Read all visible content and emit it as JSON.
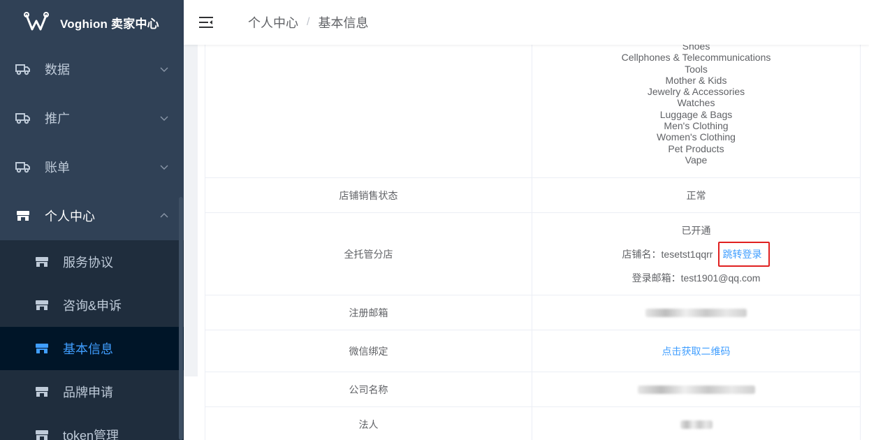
{
  "sidebar": {
    "logo_text": "Voghion 卖家中心",
    "menu": [
      {
        "label": "数据",
        "icon": "truck-icon"
      },
      {
        "label": "推广",
        "icon": "truck-icon"
      },
      {
        "label": "账单",
        "icon": "truck-icon"
      },
      {
        "label": "个人中心",
        "icon": "store-icon"
      }
    ],
    "submenu": [
      {
        "label": "服务协议",
        "icon": "store-icon"
      },
      {
        "label": "咨询&申诉",
        "icon": "store-icon"
      },
      {
        "label": "基本信息",
        "icon": "store-icon",
        "active": true
      },
      {
        "label": "品牌申请",
        "icon": "store-icon"
      },
      {
        "label": "token管理",
        "icon": "store-icon"
      }
    ]
  },
  "header": {
    "breadcrumb": [
      "个人中心",
      "基本信息"
    ],
    "separator": "/"
  },
  "table": {
    "categories": [
      "Shoes",
      "Cellphones & Telecommunications",
      "Tools",
      "Mother & Kids",
      "Jewelry & Accessories",
      "Watches",
      "Luggage & Bags",
      "Men's Clothing",
      "Women's Clothing",
      "Pet Products",
      "Vape"
    ],
    "sales_status": {
      "label": "店铺销售状态",
      "value": "正常"
    },
    "managed_store": {
      "label": "全托管分店",
      "status": "已开通",
      "store_name_label": "店铺名：",
      "store_name": "tesetst1qqrr",
      "jump_link": "跳转登录",
      "email_label": "登录邮箱：",
      "email": "test1901@qq.com"
    },
    "reg_email": {
      "label": "注册邮箱"
    },
    "wechat": {
      "label": "微信绑定",
      "link": "点击获取二维码"
    },
    "company": {
      "label": "公司名称"
    },
    "legal_person": {
      "label": "法人"
    }
  },
  "colors": {
    "sidebar_bg": "#304156",
    "submenu_bg": "#1f2d3d",
    "active_text": "#409eff",
    "highlight_box": "#e02020"
  }
}
